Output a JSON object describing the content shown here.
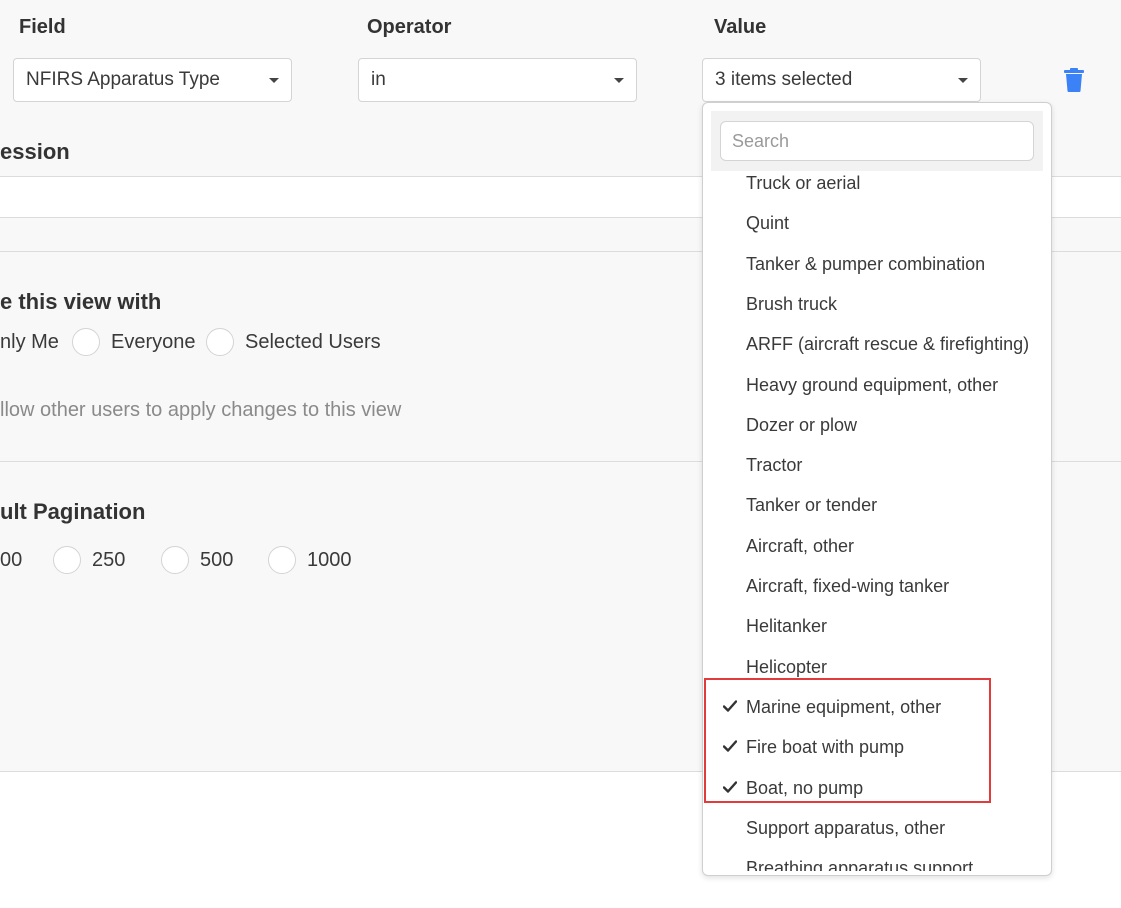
{
  "filter": {
    "field_label": "Field",
    "operator_label": "Operator",
    "value_label": "Value",
    "field_value": "NFIRS Apparatus Type",
    "operator_value": "in",
    "value_value": "3 items selected"
  },
  "expression": {
    "title": "ession"
  },
  "share": {
    "title": "e this view with",
    "options": [
      "nly Me",
      "Everyone",
      "Selected Users"
    ],
    "allow_text": "llow other users to apply changes to this view"
  },
  "pagination": {
    "title": "ult Pagination",
    "options": [
      "00",
      "250",
      "500",
      "1000"
    ]
  },
  "dropdown": {
    "search_placeholder": "Search",
    "items": [
      {
        "label": "Truck or aerial",
        "checked": false
      },
      {
        "label": "Quint",
        "checked": false
      },
      {
        "label": "Tanker & pumper combination",
        "checked": false
      },
      {
        "label": "Brush truck",
        "checked": false
      },
      {
        "label": "ARFF (aircraft rescue & firefighting)",
        "checked": false
      },
      {
        "label": "Heavy ground equipment, other",
        "checked": false
      },
      {
        "label": "Dozer or plow",
        "checked": false
      },
      {
        "label": "Tractor",
        "checked": false
      },
      {
        "label": "Tanker or tender",
        "checked": false
      },
      {
        "label": "Aircraft, other",
        "checked": false
      },
      {
        "label": "Aircraft, fixed-wing tanker",
        "checked": false
      },
      {
        "label": "Helitanker",
        "checked": false
      },
      {
        "label": "Helicopter",
        "checked": false
      },
      {
        "label": "Marine equipment, other",
        "checked": true
      },
      {
        "label": "Fire boat with pump",
        "checked": true
      },
      {
        "label": "Boat, no pump",
        "checked": true
      },
      {
        "label": "Support apparatus, other",
        "checked": false
      },
      {
        "label": "Breathing apparatus support",
        "checked": false
      }
    ]
  },
  "colors": {
    "accent": "#3b82f6",
    "highlight": "#e23b3b",
    "panel": "#f8f8f8"
  }
}
